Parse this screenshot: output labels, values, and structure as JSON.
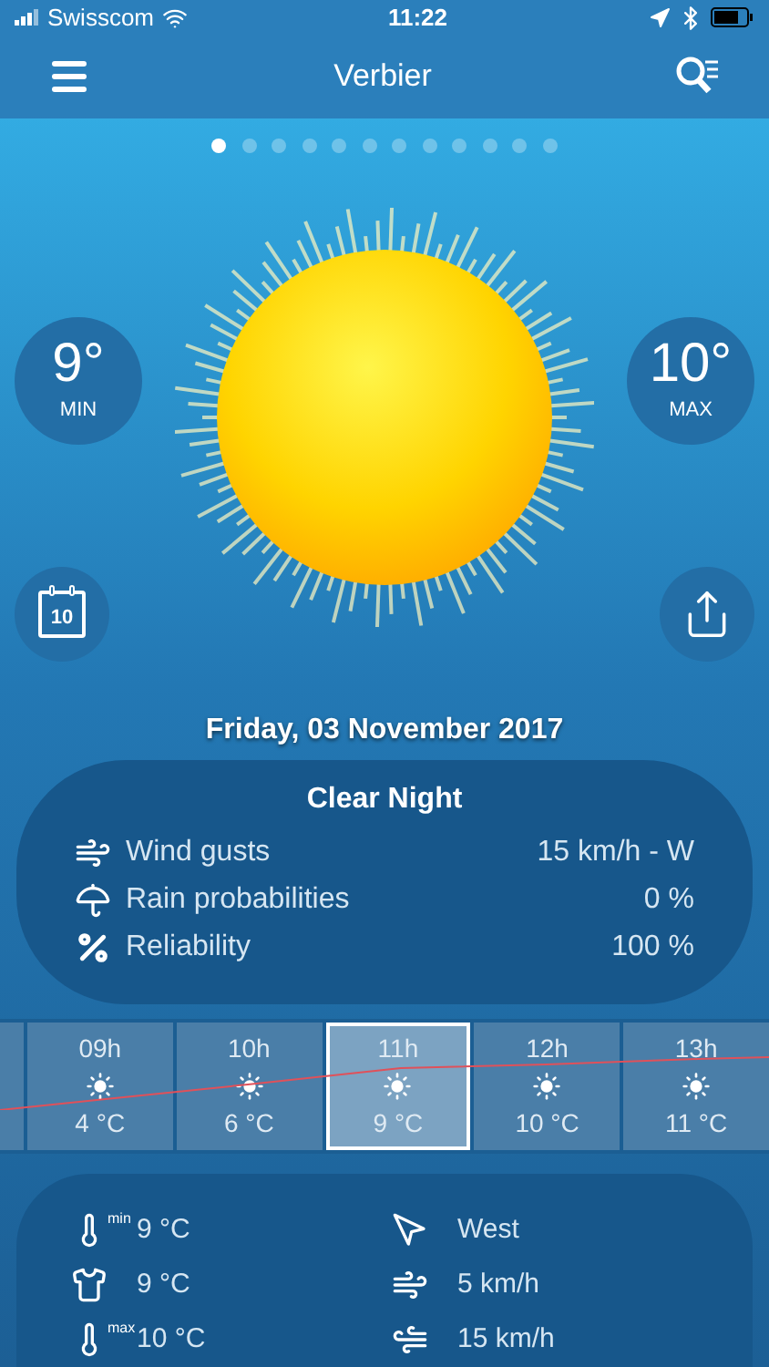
{
  "status_bar": {
    "carrier": "Swisscom",
    "time": "11:22"
  },
  "header": {
    "title": "Verbier"
  },
  "pages": [
    {
      "selected": true
    },
    {
      "selected": false
    },
    {
      "selected": false
    },
    {
      "selected": false
    },
    {
      "selected": false
    },
    {
      "selected": false
    },
    {
      "selected": false
    },
    {
      "selected": false
    },
    {
      "selected": false
    },
    {
      "selected": false
    },
    {
      "selected": false
    },
    {
      "selected": false
    }
  ],
  "min": {
    "value": "9°",
    "label": "MIN"
  },
  "max": {
    "value": "10°",
    "label": "MAX"
  },
  "calendar": {
    "day": "10"
  },
  "date": "Friday, 03 November 2017",
  "summary": {
    "title": "Clear Night",
    "rows": [
      {
        "kind": "wind",
        "label": "Wind gusts",
        "value": "15 km/h - W"
      },
      {
        "kind": "rain",
        "label": "Rain probabilities",
        "value": "0 %"
      },
      {
        "kind": "reliability",
        "label": "Reliability",
        "value": "100 %"
      }
    ]
  },
  "hours": [
    {
      "time": "09h",
      "temp": "4 °C",
      "selected": false
    },
    {
      "time": "10h",
      "temp": "6 °C",
      "selected": false
    },
    {
      "time": "11h",
      "temp": "9 °C",
      "selected": true
    },
    {
      "time": "12h",
      "temp": "10 °C",
      "selected": false
    },
    {
      "time": "13h",
      "temp": "11 °C",
      "selected": false
    }
  ],
  "details": {
    "left": [
      {
        "kind": "thermo",
        "icon_label": "min",
        "value": "9 °C"
      },
      {
        "kind": "shirt",
        "value": "9 °C"
      },
      {
        "kind": "thermo",
        "icon_label": "max",
        "value": "10 °C"
      }
    ],
    "right": [
      {
        "kind": "direction",
        "value": "West"
      },
      {
        "kind": "wind",
        "value": "5 km/h"
      },
      {
        "kind": "gust",
        "value": "15 km/h"
      }
    ]
  }
}
